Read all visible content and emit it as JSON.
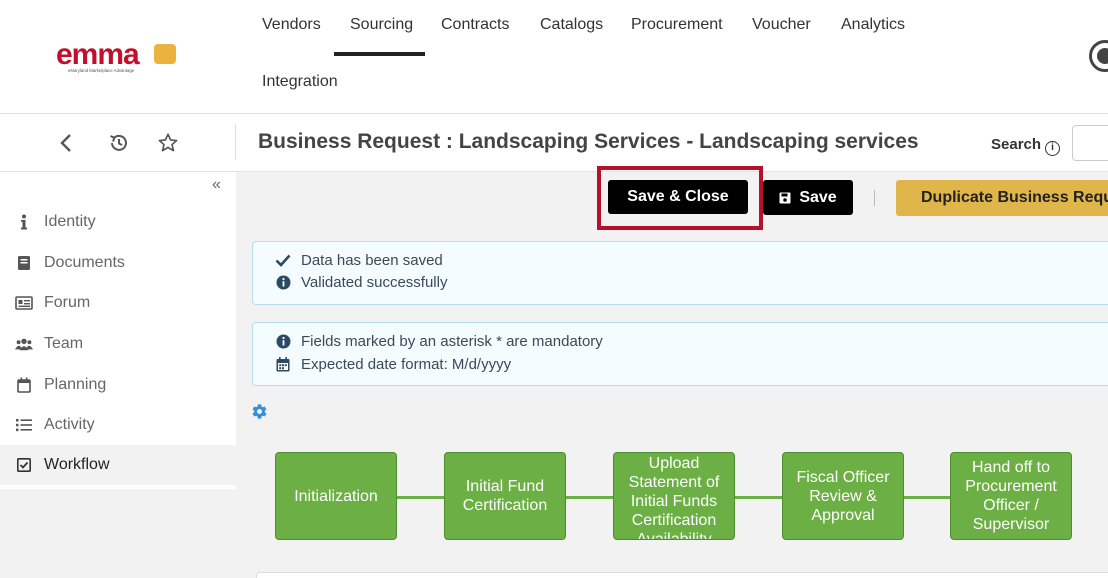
{
  "logo": {
    "text": "emma",
    "tagline": "eMaryland Marketplace Advantage"
  },
  "nav": {
    "items": [
      "Vendors",
      "Sourcing",
      "Contracts",
      "Catalogs",
      "Procurement",
      "Voucher",
      "Analytics",
      "Integration"
    ],
    "active": "Sourcing"
  },
  "header": {
    "title": "Business Request : Landscaping Services - Landscaping services",
    "search_label": "Search",
    "search_info_glyph": "i",
    "icons": [
      "back-icon",
      "history-icon",
      "star-icon"
    ]
  },
  "sidebar": {
    "collapse_glyph": "«",
    "items": [
      {
        "label": "Identity",
        "icon": "info-icon"
      },
      {
        "label": "Documents",
        "icon": "book-icon"
      },
      {
        "label": "Forum",
        "icon": "forum-icon"
      },
      {
        "label": "Team",
        "icon": "team-icon"
      },
      {
        "label": "Planning",
        "icon": "calendar-icon"
      },
      {
        "label": "Activity",
        "icon": "list-icon"
      },
      {
        "label": "Workflow",
        "icon": "checkbox-icon",
        "active": true
      }
    ]
  },
  "actions": {
    "save_close_label": "Save & Close",
    "save_label": "Save",
    "duplicate_label": "Duplicate Business Request"
  },
  "alerts": {
    "saved": [
      "Data has been saved",
      "Validated successfully"
    ],
    "info": [
      "Fields marked by an asterisk * are mandatory",
      "Expected date format: M/d/yyyy"
    ]
  },
  "workflow": {
    "steps": [
      "Initialization",
      "Initial Fund Certification",
      "Upload Statement of Initial Funds Certification Availability",
      "Fiscal Officer Review & Approval",
      "Hand off to Procurement Officer / Supervisor"
    ]
  },
  "colors": {
    "workflow_green": "#6cb045",
    "highlight_red": "#b5102e",
    "duplicate_gold": "#e0b54a",
    "logo_red": "#c0102b",
    "logo_gold": "#e8a41f"
  }
}
